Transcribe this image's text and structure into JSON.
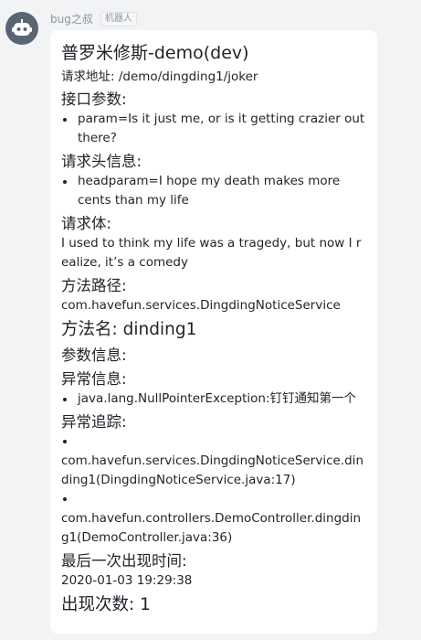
{
  "sender": {
    "name": "bug之叔",
    "badge": "机器人"
  },
  "message": {
    "title": "普罗米修斯-demo(dev)",
    "request_url_label": "请求地址:",
    "request_url_value": "/demo/dingding1/joker",
    "params_heading": "接口参数:",
    "params_items": [
      "param=Is it just me, or is it getting crazier out there?"
    ],
    "headers_heading": "请求头信息:",
    "headers_items": [
      "headparam=I hope my death makes more cents than my life"
    ],
    "body_heading": "请求体:",
    "body_text": "I used to think my life was a tragedy, but now I realize, it’s a comedy",
    "method_path_heading": "方法路径:",
    "method_path_value": "com.havefun.services.DingdingNoticeService",
    "method_name_heading": "方法名:",
    "method_name_value": "dinding1",
    "param_info_heading": "参数信息:",
    "exception_heading": "异常信息:",
    "exception_items": [
      "java.lang.NullPointerException:钉钉通知第一个"
    ],
    "trace_heading": "异常追踪:",
    "trace_items": [
      "com.havefun.services.DingdingNoticeService.dinding1(DingdingNoticeService.java:17)",
      "com.havefun.controllers.DemoController.dingding1(DemoController.java:36)"
    ],
    "last_seen_heading": "最后一次出现时间:",
    "last_seen_value": "2020-01-03 19:29:38",
    "count_heading": "出现次数:",
    "count_value": "1"
  },
  "colors": {
    "page_bg": "#f2f3f5",
    "bubble_bg": "#ffffff",
    "text": "#1f2329",
    "muted": "#8f959e",
    "avatar_bg": "#5b6473"
  },
  "icons": {
    "avatar": "robot-icon"
  }
}
